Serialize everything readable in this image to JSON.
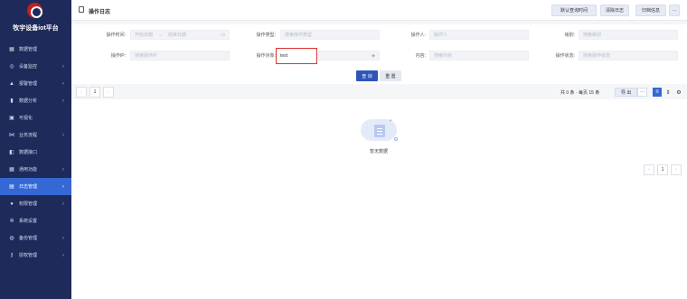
{
  "app": {
    "title": "牧宇设备iot平台"
  },
  "sidebar": {
    "items": [
      {
        "label": "数据管理",
        "icon": "table-icon",
        "has_children": false,
        "active": false
      },
      {
        "label": "设备监控",
        "icon": "monitor-icon",
        "has_children": true,
        "active": false
      },
      {
        "label": "报警管理",
        "icon": "alarm-icon",
        "has_children": true,
        "active": false
      },
      {
        "label": "数据分析",
        "icon": "chart-icon",
        "has_children": true,
        "active": false
      },
      {
        "label": "可视化",
        "icon": "screen-icon",
        "has_children": false,
        "active": false
      },
      {
        "label": "业务流程",
        "icon": "flow-icon",
        "has_children": true,
        "active": false
      },
      {
        "label": "数据接口",
        "icon": "api-icon",
        "has_children": false,
        "active": false
      },
      {
        "label": "通用功能",
        "icon": "grid-icon",
        "has_children": true,
        "active": false
      },
      {
        "label": "日志管理",
        "icon": "log-icon",
        "has_children": true,
        "active": true
      },
      {
        "label": "权限管理",
        "icon": "user-icon",
        "has_children": true,
        "active": false
      },
      {
        "label": "系统设置",
        "icon": "gear-icon",
        "has_children": false,
        "active": false
      },
      {
        "label": "备份管理",
        "icon": "backup-icon",
        "has_children": true,
        "active": false
      },
      {
        "label": "授权管理",
        "icon": "key-icon",
        "has_children": true,
        "active": false
      }
    ]
  },
  "header": {
    "title": "操作日志",
    "buttons": [
      "默认查询时间",
      "清除日志",
      "归档信息"
    ],
    "more_label": "···"
  },
  "filter": {
    "op_time_label": "操作时间:",
    "op_time_start_placeholder": "开始日期",
    "op_time_arrow": "→",
    "op_time_end_placeholder": "结束日期",
    "op_type_label": "操作类型:",
    "op_type_placeholder": "搜索操作类型",
    "operator_label": "操作人:",
    "operator_placeholder": "操作人",
    "level_label": "级别:",
    "level_placeholder": "搜索级别",
    "op_ip_label": "操作IP:",
    "op_ip_placeholder": "搜索操作IP",
    "op_target_label": "操作对象:",
    "op_target_value": "test",
    "content_label": "内容:",
    "content_placeholder": "搜索内容",
    "op_status_label": "操作状态:",
    "op_status_placeholder": "搜索操作状态",
    "query_label": "查 询",
    "reset_label": "重 置"
  },
  "pagination": {
    "prev": "‹",
    "page": "1",
    "next": "›",
    "summary": "共 0 条 · 每页 15 条",
    "export_label": "导 出",
    "more_label": "···"
  },
  "content": {
    "empty_text": "暂无数据"
  },
  "colors": {
    "sidebar_bg": "#1e2a5a",
    "active": "#3568d4",
    "primary": "#2f55b7",
    "highlight_border": "#d33333"
  }
}
